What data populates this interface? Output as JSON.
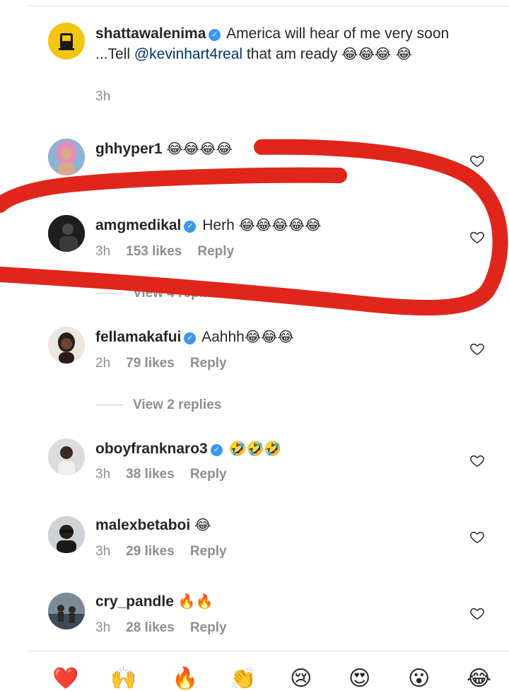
{
  "comments": [
    {
      "username": "shattawalenima",
      "verified": true,
      "text_before": "America will hear of me very soon ...Tell ",
      "mention": "@kevinhart4real",
      "text_after": " that am ready ",
      "emojis": "😂😂😂 😂",
      "time": "3h",
      "avatar": "gold-crest-avatar"
    },
    {
      "username": "ghhyper1",
      "verified": false,
      "emojis": "😂😂😂😂",
      "avatar": "pink-hair-avatar"
    },
    {
      "username": "amgmedikal",
      "verified": true,
      "text": "Herh",
      "emojis": "😂😂😂😂😂",
      "time": "3h",
      "likes": "153 likes",
      "reply": "Reply",
      "view_replies": "View 4 replies",
      "avatar": "dark-portrait-avatar"
    },
    {
      "username": "fellamakafui",
      "verified": true,
      "text": "Aahhh",
      "emojis": "😂😂😂",
      "time": "2h",
      "likes": "79 likes",
      "reply": "Reply",
      "view_replies": "View 2 replies",
      "avatar": "woman-portrait-avatar"
    },
    {
      "username": "oboyfranknaro3",
      "verified": true,
      "emojis": "🤣🤣🤣",
      "time": "3h",
      "likes": "38 likes",
      "reply": "Reply",
      "avatar": "man-portrait-avatar"
    },
    {
      "username": "malexbetaboi",
      "verified": false,
      "emojis": "😂",
      "time": "3h",
      "likes": "29 likes",
      "reply": "Reply",
      "avatar": "sunglasses-avatar"
    },
    {
      "username": "cry_pandle",
      "verified": false,
      "emojis": "🔥🔥",
      "time": "3h",
      "likes": "28 likes",
      "reply": "Reply",
      "avatar": "stage-avatar"
    }
  ],
  "reactions": [
    "❤️",
    "🙌",
    "🔥",
    "👏",
    "😢",
    "😍",
    "😮",
    "😂"
  ],
  "colors": {
    "annotation_stroke": "#e0261b",
    "verified_badge": "#3897f0",
    "mention": "#003569",
    "meta_gray": "#8e8e8e"
  }
}
